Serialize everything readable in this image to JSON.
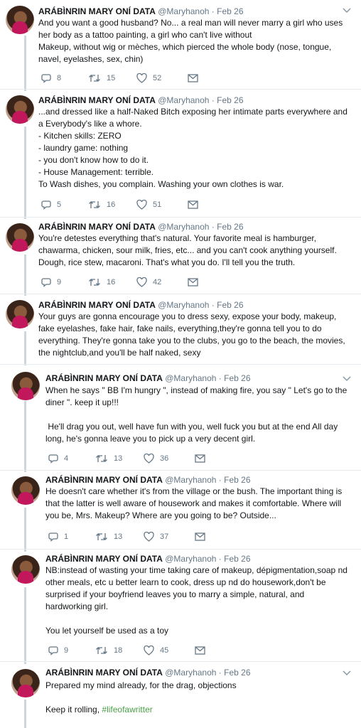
{
  "tweets": [
    {
      "name": "ARÁBÌNRIN MARY ONÍ DATA",
      "handle": "@Maryhanoh",
      "date": "Feb 26",
      "text": "And you want a good husband? No... a real man will never marry a girl who uses her body as a tattoo painting, a girl who can't live without\nMakeup, without wig or mèches, which pierced the whole body (nose, tongue, navel, eyelashes, sex, chin)",
      "replies": "8",
      "retweets": "15",
      "likes": "52"
    },
    {
      "name": "ARÁBÌNRIN MARY ONÍ DATA",
      "handle": "@Maryhanoh",
      "date": "Feb 26",
      "text": "...and dressed like a half-Naked Bitch exposing her intimate parts everywhere and a Everybody's like a whore.\n- Kitchen skills: ZERO\n- laundry game: nothing\n- you don't know how to do it.\n- House Management: terrible.\nTo Wash dishes, you complain. Washing your own clothes is war.",
      "replies": "5",
      "retweets": "16",
      "likes": "51"
    },
    {
      "name": "ARÁBÌNRIN MARY ONÍ DATA",
      "handle": "@Maryhanoh",
      "date": "Feb 26",
      "text": "You're detestes everything that's natural. Your favorite meal is hamburger, chawarma, chicken, sour milk, fries, etc... and you can't cook anything yourself. Dough, rice stew, macaroni. That's what you do. I'll tell you the truth.",
      "replies": "9",
      "retweets": "16",
      "likes": "42"
    },
    {
      "name": "ARÁBÌNRIN MARY ONÍ DATA",
      "handle": "@Maryhanoh",
      "date": "Feb 26",
      "text": "Your guys are gonna encourage you to dress sexy, expose your body, makeup, fake eyelashes, fake hair, fake nails, everything,they're gonna tell you to do everything. They're gonna take you to the clubs, you go to the beach, the movies, the nightclub,and you'll be half naked, sexy"
    },
    {
      "name": "ARÁBÌNRIN MARY ONÍ DATA",
      "handle": "@Maryhanoh",
      "date": "Feb 26",
      "text": "When he says \" BB I'm hungry \", instead of making fire, you say \" Let's go to the diner \". keep it up!!!\n\n He'll drag you out, well have fun with you, well fuck you but at the end All day long, he's gonna leave you to pick up a very decent girl.",
      "replies": "4",
      "retweets": "13",
      "likes": "36"
    },
    {
      "name": "ARÁBÌNRIN MARY ONÍ DATA",
      "handle": "@Maryhanoh",
      "date": "Feb 26",
      "text": "He doesn't care whether it's from the village or the bush. The important thing is that the latter is well aware of housework and makes it comfortable. Where will you be, Mrs. Makeup? Where are you going to be? Outside...",
      "replies": "1",
      "retweets": "13",
      "likes": "37"
    },
    {
      "name": "ARÁBÌNRIN MARY ONÍ DATA",
      "handle": "@Maryhanoh",
      "date": "Feb 26",
      "text": "NB:instead of wasting your time taking care of makeup, dépigmentation,soap nd other meals, etc u better learn to cook, dress up nd do housework,don't be surprised if your boyfriend leaves you to marry a simple, natural, and hardworking girl.\n\nYou let yourself be used as a toy",
      "replies": "9",
      "retweets": "18",
      "likes": "45"
    },
    {
      "name": "ARÁBÌNRIN MARY ONÍ DATA",
      "handle": "@Maryhanoh",
      "date": "Feb 26",
      "text": "Prepared my mind already, for the drag, objections\n\nKeep it rolling, ",
      "hashtag": "#lifeofawritter"
    }
  ],
  "colors": {
    "hashtag": "#4aa04a",
    "thread_line": "#ccd6dd",
    "meta": "#657786"
  },
  "icons": [
    "reply-icon",
    "retweet-icon",
    "like-icon",
    "message-icon",
    "chevron-down-icon"
  ]
}
